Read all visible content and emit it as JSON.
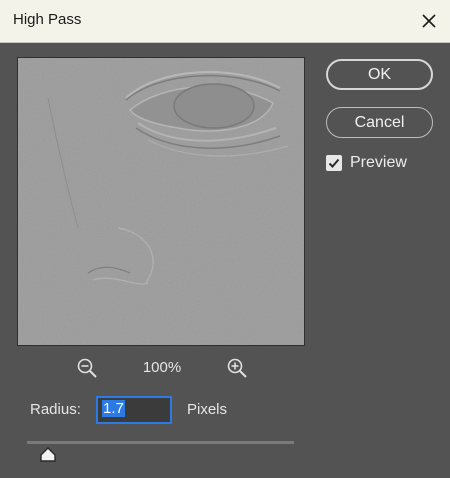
{
  "window": {
    "title": "High Pass"
  },
  "buttons": {
    "ok_label": "OK",
    "cancel_label": "Cancel"
  },
  "preview_option": {
    "label": "Preview",
    "checked": true
  },
  "zoom": {
    "level": "100%"
  },
  "radius": {
    "label": "Radius:",
    "value": "1.7",
    "unit": "Pixels"
  },
  "slider": {
    "position_fraction": 0.06
  },
  "colors": {
    "dialog_bg": "#535353",
    "titlebar_bg": "#f4f3ea",
    "accent": "#2c7be5",
    "preview_gray": "#9a9a9a"
  },
  "icons": [
    "close-icon",
    "zoom-out-icon",
    "zoom-in-icon",
    "checkmark-icon",
    "slider-thumb-icon"
  ]
}
